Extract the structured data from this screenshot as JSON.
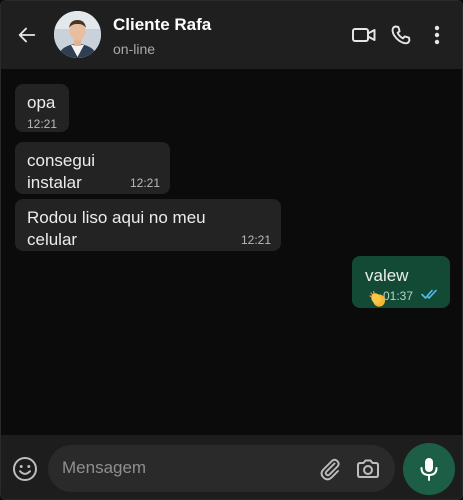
{
  "header": {
    "contact_name": "Cliente Rafa",
    "status": "on-line",
    "icons": {
      "back": "arrow-left-icon",
      "avatar": "profile-photo",
      "video": "video-camera-icon",
      "call": "phone-icon",
      "menu": "vertical-dots-icon"
    }
  },
  "messages": [
    {
      "direction": "incoming",
      "text": "opa",
      "time": "12:21"
    },
    {
      "direction": "incoming",
      "lines": [
        "consegui",
        "instalar"
      ],
      "time": "12:21"
    },
    {
      "direction": "incoming",
      "lines": [
        "Rodou liso aqui no meu",
        "celular"
      ],
      "time": "12:21"
    },
    {
      "direction": "outgoing",
      "text": "valew",
      "time": "01:37",
      "status": "read",
      "reaction": "clapping-hands-emoji"
    }
  ],
  "composer": {
    "placeholder": "Mensagem",
    "value": "",
    "icons": {
      "emoji": "emoji-smiley-icon",
      "attach": "paperclip-icon",
      "camera": "camera-icon",
      "mic": "microphone-icon"
    }
  },
  "colors": {
    "header_bg": "#1f1f1f",
    "chat_bg": "#0b0b0b",
    "incoming_bubble": "#232323",
    "outgoing_bubble": "#124a35",
    "read_ticks": "#53bdeb",
    "mic_button": "#1c5e46"
  }
}
